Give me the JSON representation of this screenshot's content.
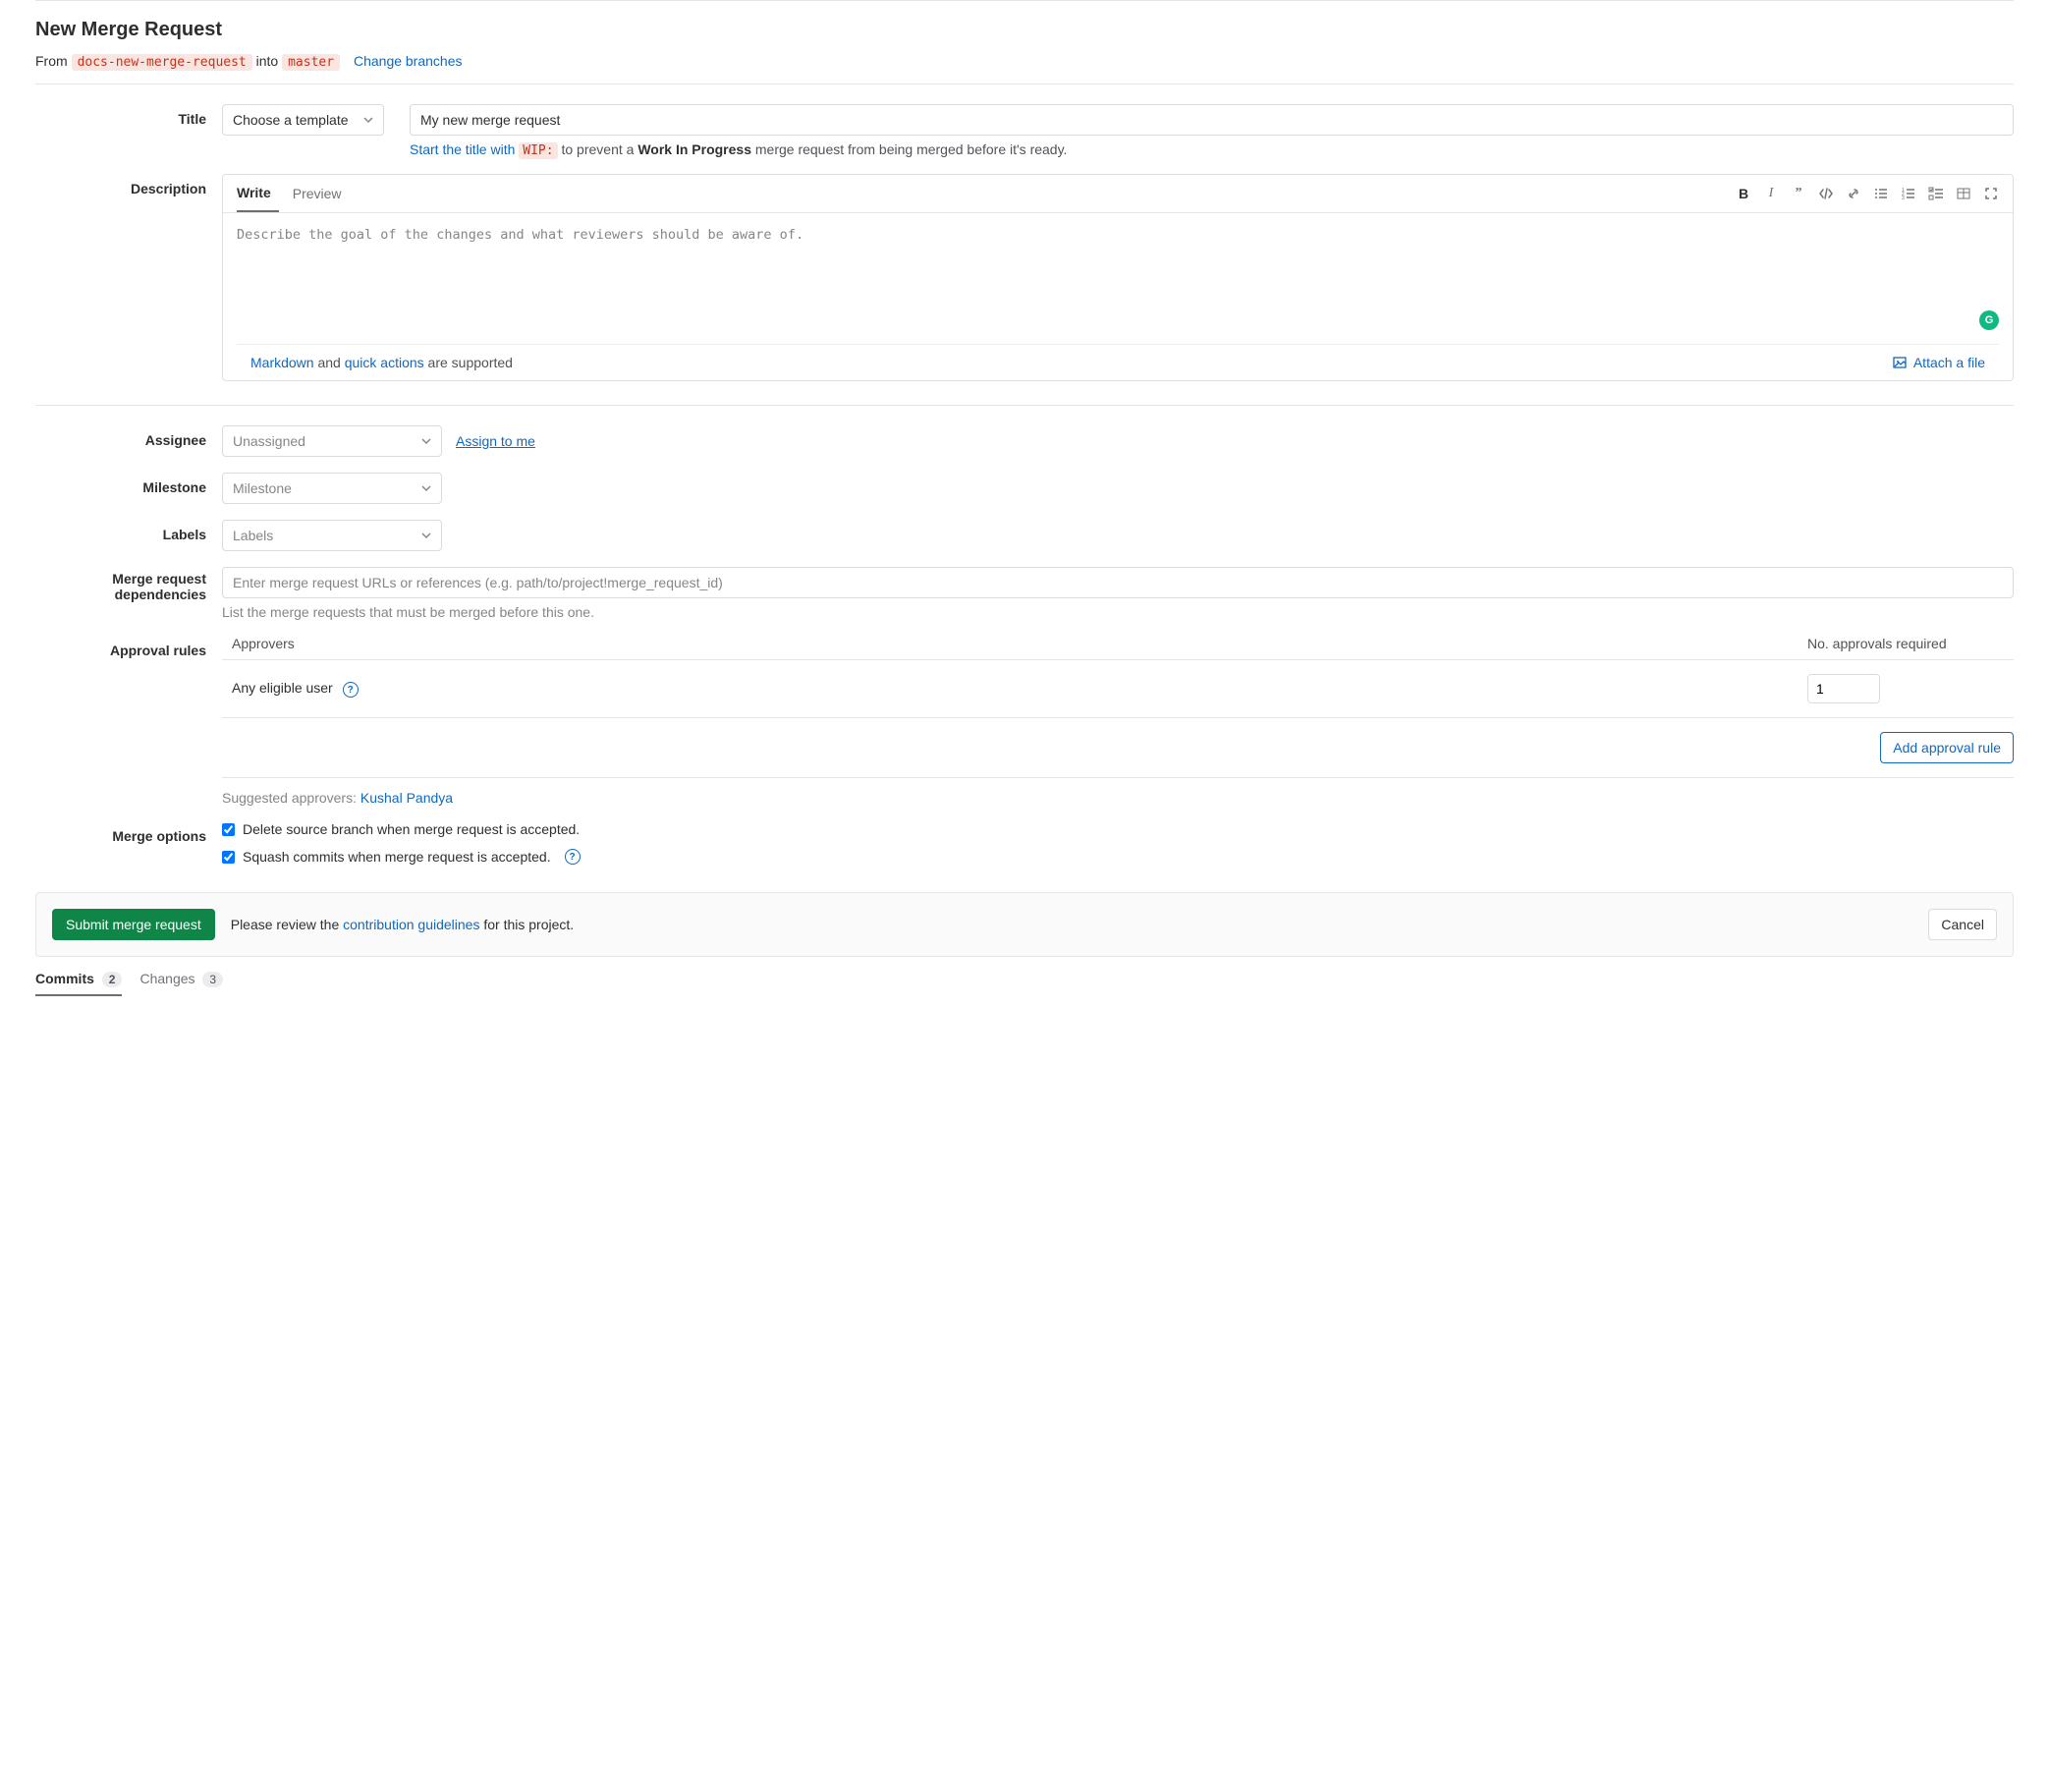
{
  "header": {
    "title": "New Merge Request",
    "from_text": "From",
    "from_branch": "docs-new-merge-request",
    "into_text": "into",
    "into_branch": "master",
    "change_branches": "Change branches"
  },
  "title_section": {
    "label": "Title",
    "template_select": "Choose a template",
    "title_value": "My new merge request",
    "hint_prefix": "Start the title with",
    "hint_code": "WIP:",
    "hint_mid": "to prevent a",
    "hint_strong": "Work In Progress",
    "hint_suffix": "merge request from being merged before it's ready."
  },
  "description_section": {
    "label": "Description",
    "tabs": {
      "write": "Write",
      "preview": "Preview"
    },
    "placeholder": "Describe the goal of the changes and what reviewers should be aware of.",
    "footer_md": "Markdown",
    "footer_and": " and ",
    "footer_qa": "quick actions",
    "footer_supported": " are supported",
    "attach": "Attach a file"
  },
  "assignee": {
    "label": "Assignee",
    "value": "Unassigned",
    "assign_to_me": "Assign to me"
  },
  "milestone": {
    "label": "Milestone",
    "value": "Milestone"
  },
  "labels": {
    "label": "Labels",
    "value": "Labels"
  },
  "dependencies": {
    "label": "Merge request dependencies",
    "placeholder": "Enter merge request URLs or references (e.g. path/to/project!merge_request_id)",
    "hint": "List the merge requests that must be merged before this one."
  },
  "approval": {
    "label": "Approval rules",
    "col_approvers": "Approvers",
    "col_required": "No. approvals required",
    "row_name": "Any eligible user",
    "required_value": "1",
    "add_rule": "Add approval rule",
    "suggested_prefix": "Suggested approvers: ",
    "suggested_name": "Kushal Pandya"
  },
  "merge_options": {
    "label": "Merge options",
    "opt_delete": "Delete source branch when merge request is accepted.",
    "opt_squash": "Squash commits when merge request is accepted."
  },
  "submit": {
    "button": "Submit merge request",
    "review_prefix": "Please review the ",
    "guidelines": "contribution guidelines",
    "review_suffix": " for this project.",
    "cancel": "Cancel"
  },
  "bottom_tabs": {
    "commits": "Commits",
    "commits_count": "2",
    "changes": "Changes",
    "changes_count": "3"
  }
}
